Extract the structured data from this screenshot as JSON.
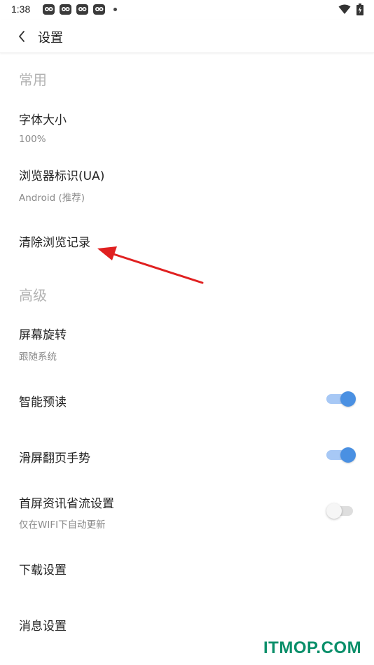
{
  "status_bar": {
    "time": "1:38",
    "notification_icons": [
      "app-notification-icon",
      "app-notification-icon",
      "app-notification-icon",
      "app-notification-icon"
    ],
    "icons": [
      "wifi-icon",
      "battery-charging-icon"
    ]
  },
  "app_bar": {
    "back_icon": "chevron-left-icon",
    "title": "设置"
  },
  "sections": {
    "common": {
      "header": "常用",
      "font_size": {
        "title": "字体大小",
        "value": "100%"
      },
      "user_agent": {
        "title": "浏览器标识(UA)",
        "value": "Android (推荐)"
      },
      "clear_history": {
        "title": "清除浏览记录"
      }
    },
    "advanced": {
      "header": "高级",
      "screen_rotation": {
        "title": "屏幕旋转",
        "value": "跟随系统"
      },
      "smart_preload": {
        "title": "智能预读",
        "enabled": true
      },
      "swipe_gesture": {
        "title": "滑屏翻页手势",
        "enabled": true
      },
      "data_saver": {
        "title": "首屏资讯省流设置",
        "subtitle": "仅在WIFI下自动更新",
        "enabled": false
      },
      "download_settings": {
        "title": "下载设置"
      },
      "message_settings": {
        "title": "消息设置"
      }
    }
  },
  "colors": {
    "accent": "#4a90e2",
    "annotation_arrow": "#e02020",
    "watermark": "#0a8f6a"
  },
  "watermark": "ITMOP.COM"
}
